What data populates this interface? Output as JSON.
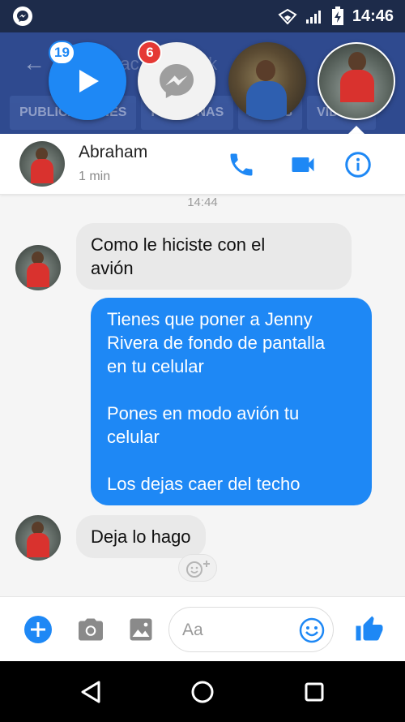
{
  "status_bar": {
    "time": "14:46",
    "icons": [
      "messenger-icon",
      "wifi-icon",
      "signal-icon",
      "battery-charging-icon"
    ]
  },
  "background_app": {
    "title": "...ac... de ...ok",
    "tabs": [
      "PUBLICACIONES",
      "PERSONAS",
      "FOTOS",
      "VIDEOS"
    ]
  },
  "chat_heads": {
    "video_badge": "19",
    "messenger_badge": "6"
  },
  "conversation": {
    "contact_name": "Abraham",
    "last_active": "1 min",
    "timestamp": "14:44",
    "messages": [
      {
        "direction": "incoming",
        "text": "Como le hiciste con el\navión"
      },
      {
        "direction": "outgoing",
        "text": "Tienes que poner a Jenny\nRivera de fondo de pantalla\nen tu celular\n\nPones en modo avión tu\ncelular\n\nLos dejas caer del techo"
      },
      {
        "direction": "incoming",
        "text": "Deja lo hago"
      }
    ]
  },
  "composer": {
    "placeholder": "Aa"
  },
  "colors": {
    "accent": "#1e88f5",
    "incoming_bubble": "#e9e9e9",
    "status_bar": "#1d2b4a",
    "badge_red": "#e53935"
  }
}
